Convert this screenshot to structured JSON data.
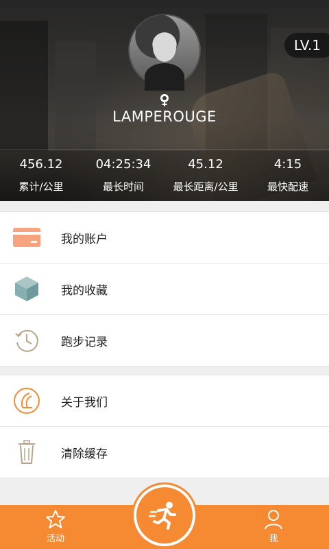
{
  "profile": {
    "level": "LV.1",
    "username": "LAMPEROUGE",
    "gender_icon": "female-icon"
  },
  "stats": [
    {
      "value": "456.12",
      "label": "累计/公里"
    },
    {
      "value": "04:25:34",
      "label": "最长时间"
    },
    {
      "value": "45.12",
      "label": "最长距离/公里"
    },
    {
      "value": "4:15",
      "label": "最快配速"
    }
  ],
  "menu_group_1": [
    {
      "label": "我的账户",
      "icon": "wallet-card-icon",
      "color": "#f7a37f"
    },
    {
      "label": "我的收藏",
      "icon": "cube-icon",
      "color": "#87aeb0"
    },
    {
      "label": "跑步记录",
      "icon": "history-clock-icon",
      "color": "#b9a58a"
    }
  ],
  "menu_group_2": [
    {
      "label": "关于我们",
      "icon": "about-logo-icon",
      "color": "#f68a33"
    },
    {
      "label": "清除缓存",
      "icon": "trash-icon",
      "color": "#b9a58a"
    }
  ],
  "tabbar": {
    "left_label": "活动",
    "right_label": "我",
    "accent": "#f68a33",
    "center_icon": "runner-icon"
  }
}
